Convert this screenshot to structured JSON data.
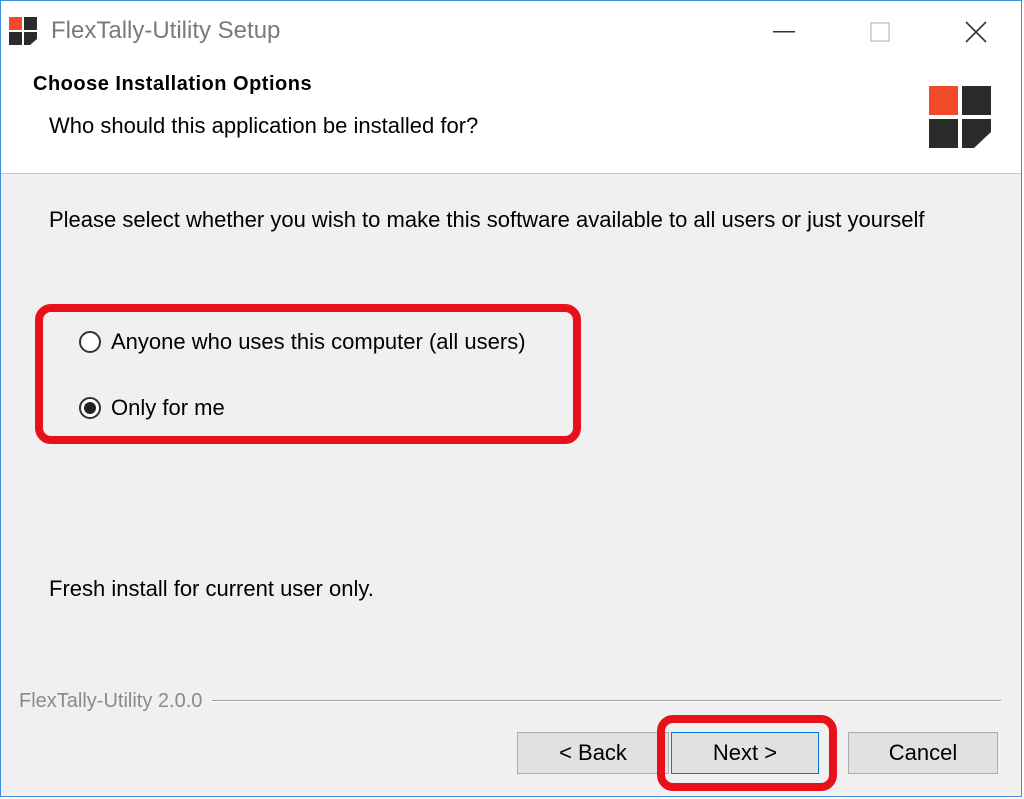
{
  "window": {
    "title": "FlexTally-Utility Setup",
    "border_color": "#3c8ee0"
  },
  "title_controls": {
    "minimize_icon": "minimize-icon",
    "maximize_icon": "maximize-icon",
    "close_icon": "close-icon"
  },
  "header": {
    "title": "Choose Installation Options",
    "subtitle": "Who should this application be installed for?",
    "logo_colors": [
      "#f04a2a",
      "#2b2b2b"
    ]
  },
  "instruction": "Please select whether you wish to make this software available to all users or just yourself",
  "options": [
    {
      "label": "Anyone who uses this computer (all users)",
      "selected": false
    },
    {
      "label": "Only for me",
      "selected": true
    }
  ],
  "status": "Fresh install for current user only.",
  "version": "FlexTally-Utility 2.0.0",
  "buttons": {
    "back": "< Back",
    "next": "Next >",
    "cancel": "Cancel"
  },
  "highlight_color": "#e8101a"
}
